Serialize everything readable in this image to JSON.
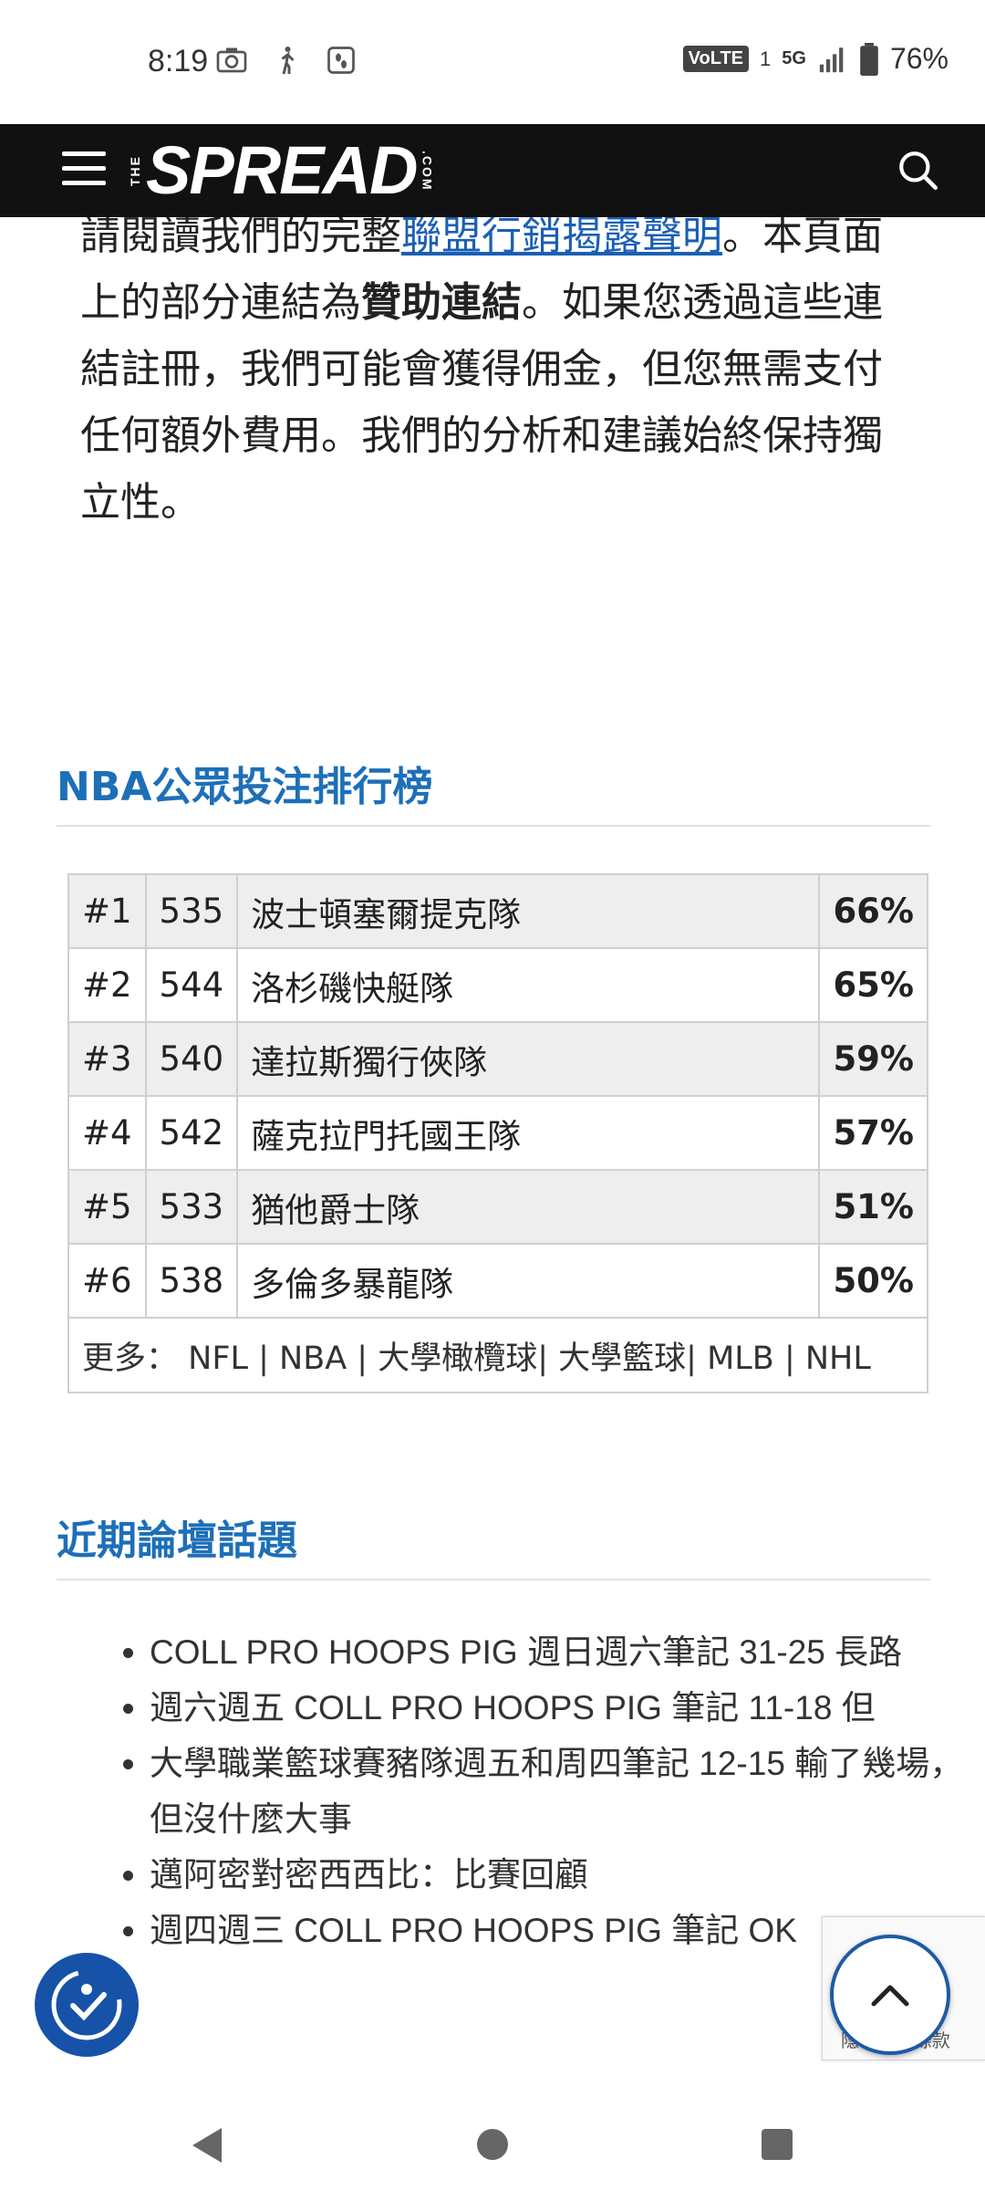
{
  "status_bar": {
    "time": "8:19",
    "network_badge": "VoLTE",
    "sim": "1",
    "network_type": "5G",
    "battery": "76%"
  },
  "header": {
    "logo_main": "SPREAD",
    "logo_left": "THE",
    "logo_right": ".COM"
  },
  "disclosure": {
    "part1": "請閱讀我們的完整",
    "link": "聯盟行銷揭露聲明",
    "part2": "。本頁面上的部分連結為",
    "bold": "贊助連結",
    "part3": "。如果您透過這些連結註冊，我們可能會獲得佣金，但您無需支付任何額外費用。我們的分析和建議始終保持獨立性。"
  },
  "betting": {
    "title": "NBA公眾投注排行榜",
    "rows": [
      {
        "rank": "#1",
        "num": "535",
        "team": "波士頓塞爾提克隊",
        "pct": "66%"
      },
      {
        "rank": "#2",
        "num": "544",
        "team": "洛杉磯快艇隊",
        "pct": "65%"
      },
      {
        "rank": "#3",
        "num": "540",
        "team": "達拉斯獨行俠隊",
        "pct": "59%"
      },
      {
        "rank": "#4",
        "num": "542",
        "team": "薩克拉門托國王隊",
        "pct": "57%"
      },
      {
        "rank": "#5",
        "num": "533",
        "team": "猶他爵士隊",
        "pct": "51%"
      },
      {
        "rank": "#6",
        "num": "538",
        "team": "多倫多暴龍隊",
        "pct": "50%"
      }
    ],
    "more_label": "更多：",
    "more_links": [
      "NFL",
      "NBA",
      "大學橄欖球",
      "大學籃球",
      "MLB",
      "NHL"
    ]
  },
  "forum": {
    "title": "近期論壇話題",
    "items": [
      "COLL PRO HOOPS PIG 週日週六筆記 31-25 長路",
      "週六週五 COLL PRO HOOPS PIG 筆記 11-18 但",
      "大學職業籃球賽豬隊週五和周四筆記 12-15 輸了幾場，但沒什麼大事",
      "邁阿密對密西西比：比賽回顧",
      "週四週三 COLL PRO HOOPS PIG 筆記 OK"
    ]
  },
  "recaptcha": {
    "text": "隱私權 - 條款"
  }
}
